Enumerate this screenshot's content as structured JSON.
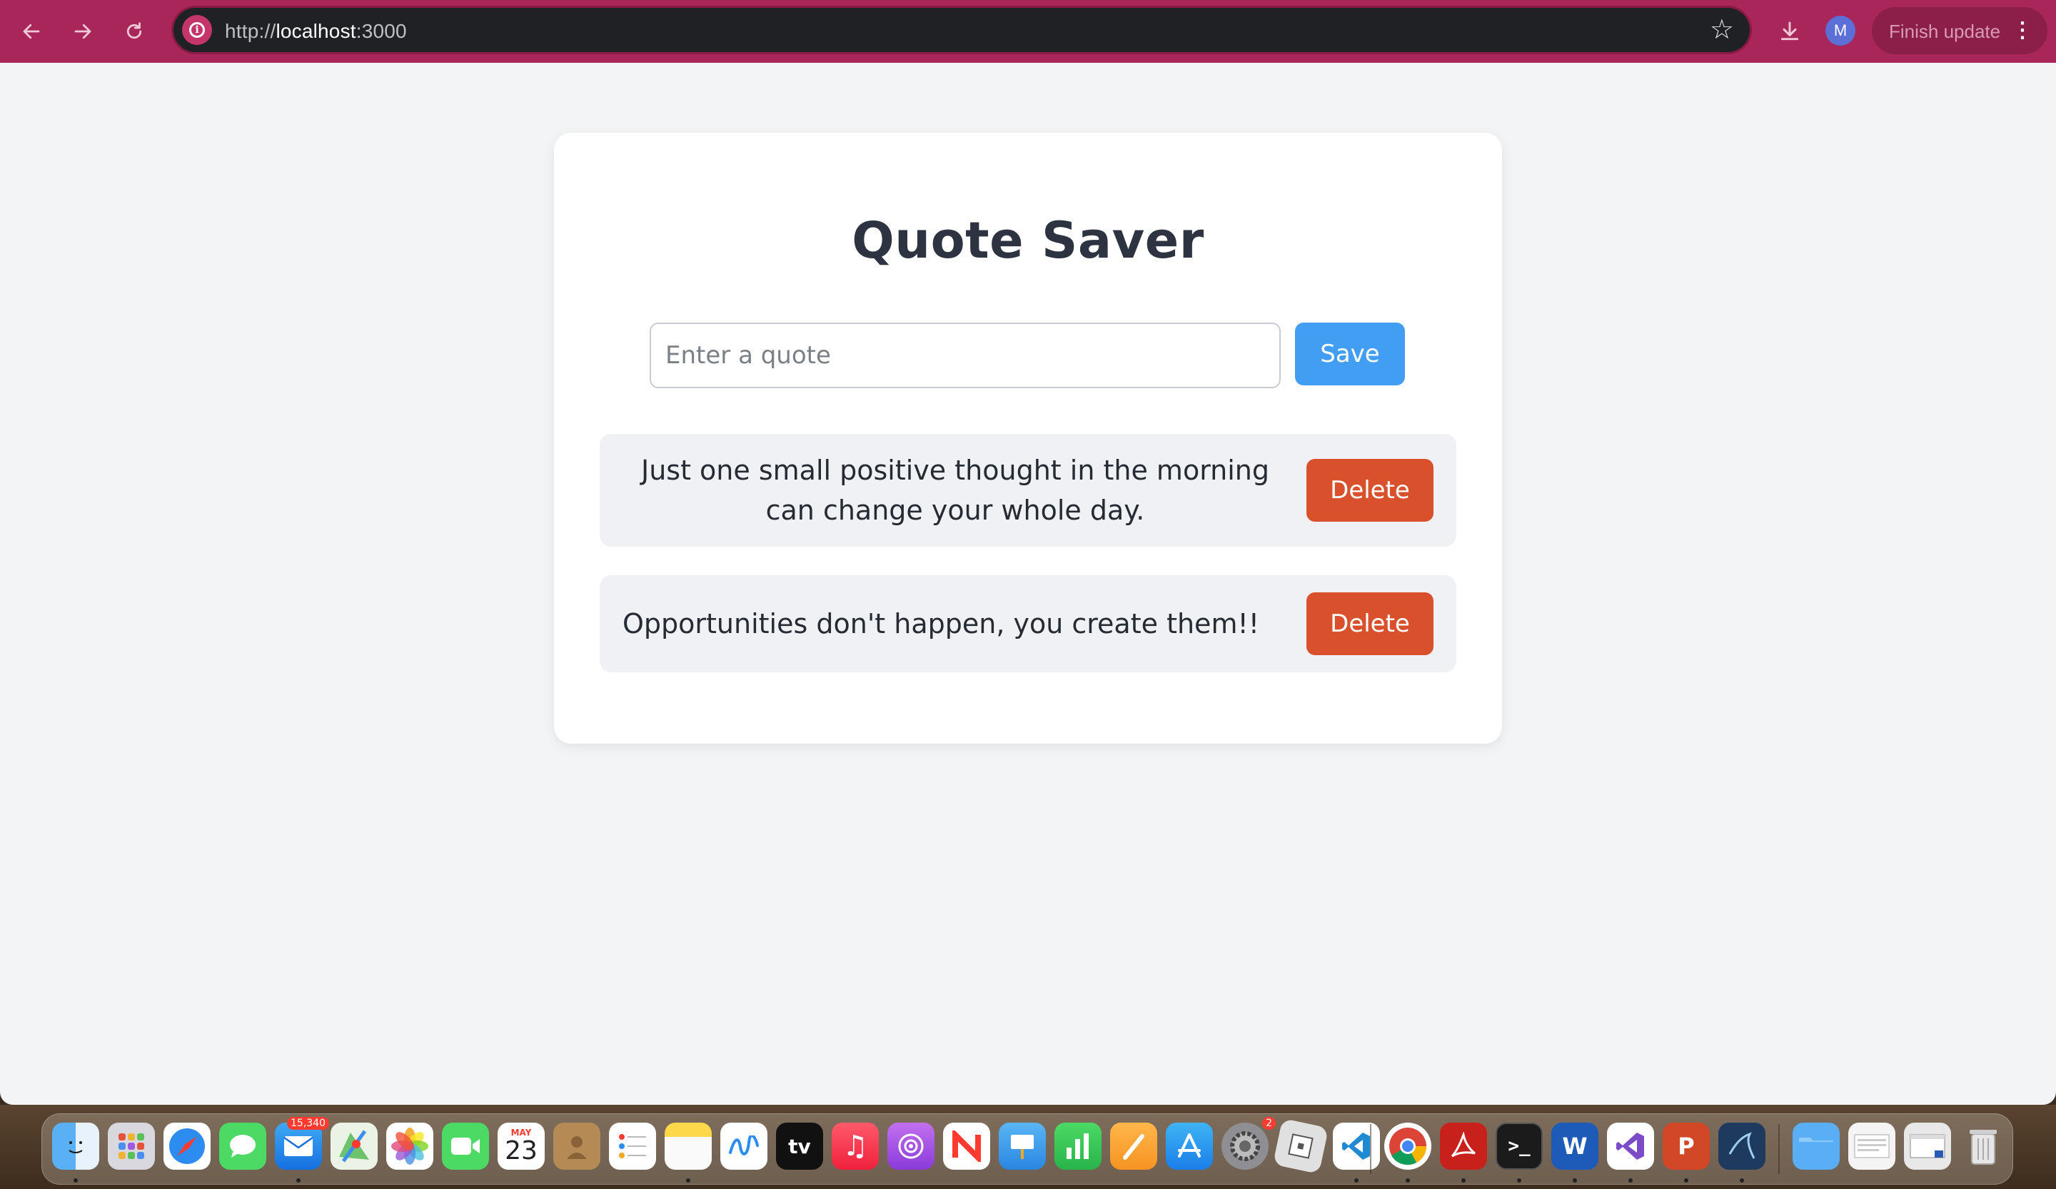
{
  "browser": {
    "url_scheme": "http://",
    "url_host": "localhost",
    "url_port": ":3000",
    "profile_initial": "M",
    "finish_update_label": "Finish update",
    "theme_color": "#a8265a"
  },
  "app": {
    "title": "Quote Saver",
    "input_placeholder": "Enter a quote",
    "input_value": "",
    "save_label": "Save",
    "accent_color": "#429ef3",
    "delete_color": "#d9502c",
    "quotes": [
      {
        "text": "Just one small positive thought in the morning can change your whole day.",
        "delete_label": "Delete"
      },
      {
        "text": "Opportunities don't happen, you create them!!",
        "delete_label": "Delete"
      }
    ]
  },
  "dock": {
    "mail_badge": "15,340",
    "calendar_month": "MAY",
    "calendar_day": "23",
    "settings_badge": "2",
    "apple_tv_label": "tv",
    "word_letter": "W",
    "powerpoint_letter": "P"
  }
}
